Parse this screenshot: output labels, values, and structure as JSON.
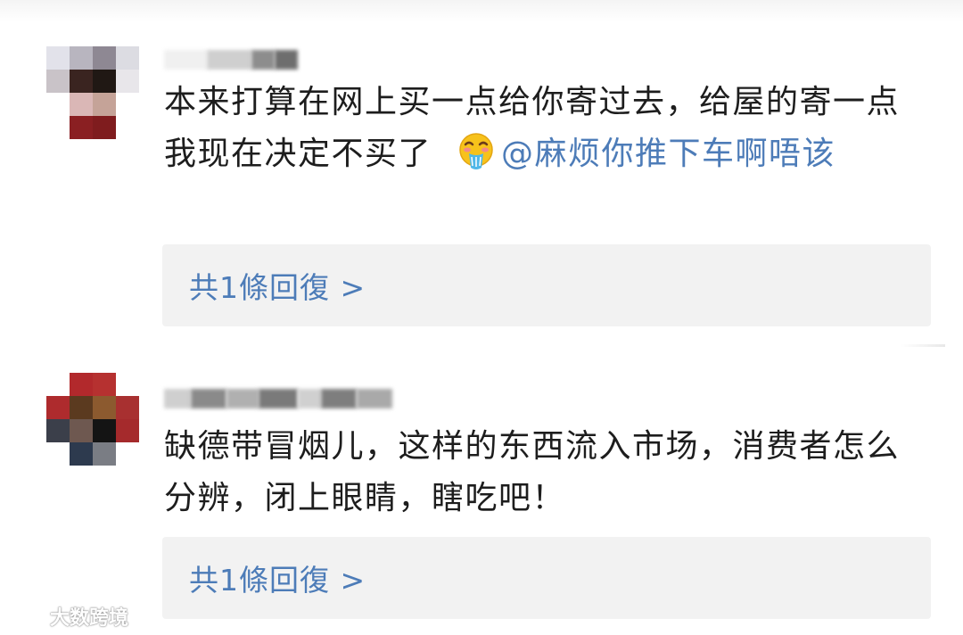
{
  "comments": [
    {
      "text_before": "本来打算在网上买一点给你寄过去，给屋的寄一点　我现在决定不买了",
      "emoji": "vomiting-face-emoji",
      "mention": "@麻烦你推下车啊唔该",
      "reply_link": "共1條回復 >",
      "avatar_colors": [
        "#e2e2ea",
        "#b8b5bf",
        "#8e8893",
        "#dcdce2",
        "#c9c3c8",
        "#3a2420",
        "#201814",
        "#e8e6ea",
        "#ffffff",
        "#dab7b6",
        "#c5a398",
        "#ffffff",
        "#ffffff",
        "#8a1f22",
        "#7f1c1e",
        "#ffffff"
      ]
    },
    {
      "text_before": "缺德带冒烟儿，这样的东西流入市场，消费者怎么分辨，闭上眼睛，瞎吃吧！",
      "reply_link": "共1條回復 >",
      "avatar_colors": [
        "#ffffff",
        "#b2292c",
        "#b63130",
        "#ffffff",
        "#ae2b2d",
        "#5b3a1f",
        "#8c5a2f",
        "#a83030",
        "#3b3f4a",
        "#6e5850",
        "#141414",
        "#a52a2c",
        "#ffffff",
        "#2d3a4e",
        "#7a7d84",
        "#ffffff"
      ]
    }
  ],
  "watermark": {
    "text": "大数跨境"
  },
  "colors": {
    "link": "#4d7cb8",
    "reply_bg": "#f2f2f2",
    "text": "#1d1d1d"
  }
}
